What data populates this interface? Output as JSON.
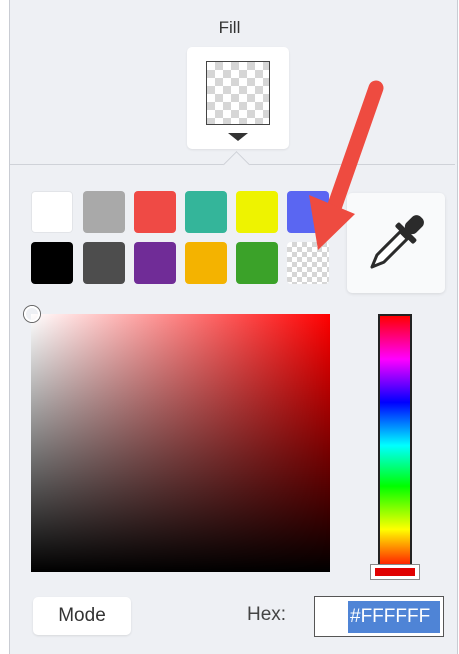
{
  "fill": {
    "title": "Fill",
    "current": "transparent"
  },
  "palette": {
    "swatches": [
      {
        "name": "white",
        "color": "#ffffff"
      },
      {
        "name": "light-gray",
        "color": "#a9a9a9"
      },
      {
        "name": "red",
        "color": "#ef4a45"
      },
      {
        "name": "teal",
        "color": "#34b59a"
      },
      {
        "name": "yellow",
        "color": "#eef300"
      },
      {
        "name": "blue",
        "color": "#5a66f2"
      },
      {
        "name": "black",
        "color": "#000000"
      },
      {
        "name": "dark-gray",
        "color": "#4d4d4d"
      },
      {
        "name": "purple",
        "color": "#702c97"
      },
      {
        "name": "orange",
        "color": "#f4b300"
      },
      {
        "name": "green",
        "color": "#3ba229"
      },
      {
        "name": "transparent",
        "color": "transparent"
      }
    ]
  },
  "picker": {
    "hue_color": "#ff0000",
    "mode_label": "Mode",
    "hex_label": "Hex:",
    "hex_value": "#FFFFFF"
  },
  "annotation": {
    "arrow_color": "#ee4b40"
  },
  "icons": [
    "eyedropper-icon",
    "caret-down-icon"
  ]
}
